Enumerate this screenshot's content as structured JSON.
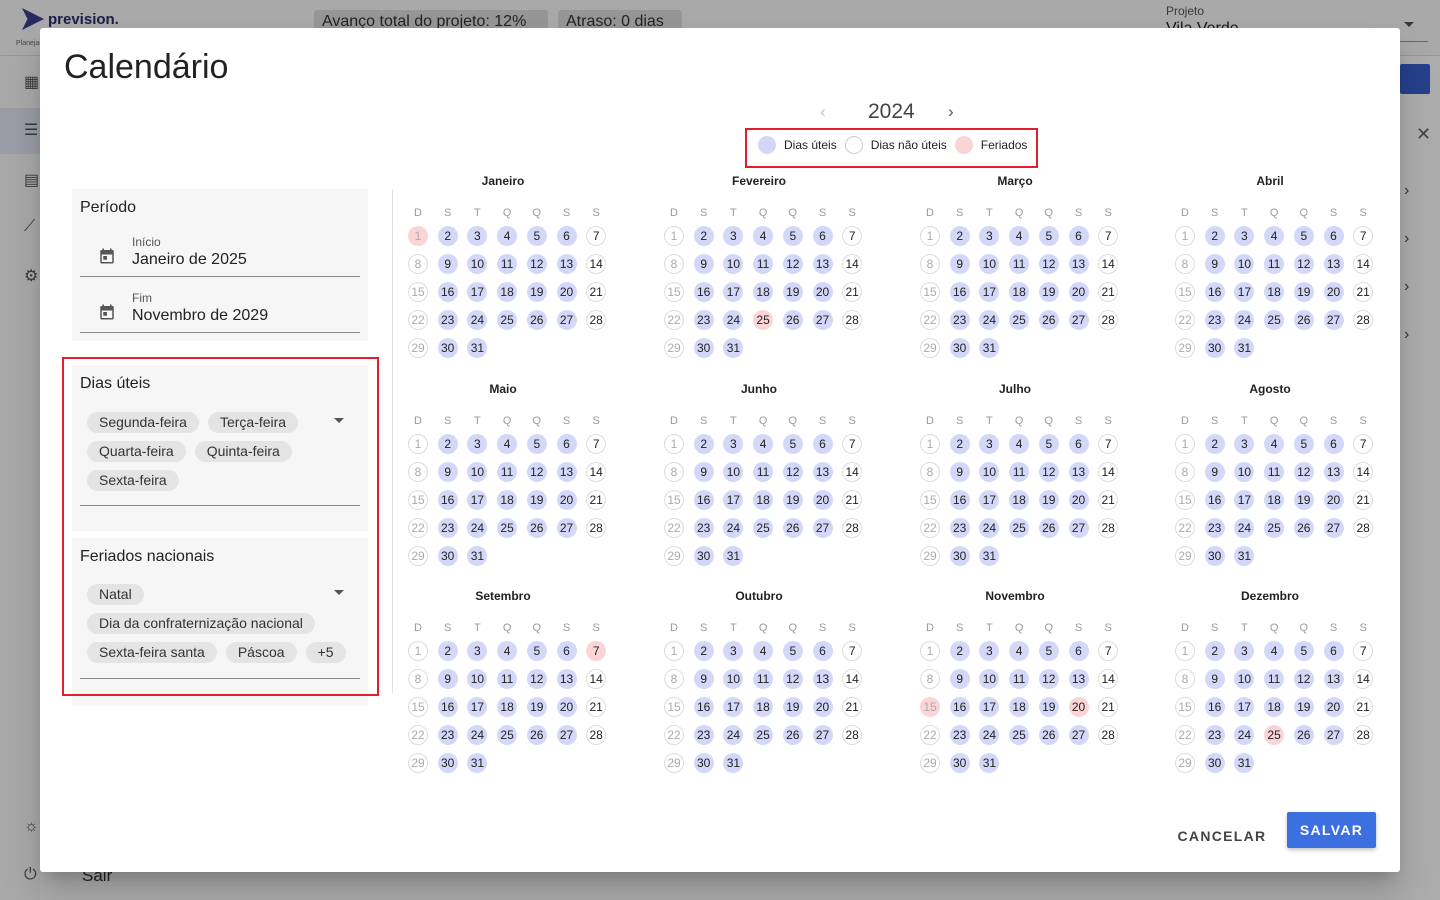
{
  "app": {
    "logo_text": "prevision.",
    "logo_sub": "Planejamento",
    "progress_chip": "Avanço total do projeto: 12%",
    "delay_chip": "Atraso: 0 dias",
    "project_label": "Projeto",
    "project_value": "Vila Verde",
    "exit_label": "Sair"
  },
  "dialog": {
    "title": "Calendário",
    "periodo": {
      "title": "Período",
      "start_label": "Início",
      "start_value": "Janeiro de 2025",
      "end_label": "Fim",
      "end_value": "Novembro de 2029"
    },
    "dias_uteis": {
      "title": "Dias úteis",
      "chips": [
        "Segunda-feira",
        "Terça-feira",
        "Quarta-feira",
        "Quinta-feira",
        "Sexta-feira"
      ]
    },
    "feriados": {
      "title": "Feriados nacionais",
      "chips": [
        "Natal",
        "Dia da confraternização nacional",
        "Sexta-feira santa",
        "Páscoa",
        "+5"
      ]
    },
    "year": "2024",
    "legend": {
      "work": "Dias úteis",
      "off": "Dias não úteis",
      "holiday": "Feriados",
      "colors": {
        "work": "#d3d8f8",
        "off": "#ffffff",
        "holiday": "#fbd5d5"
      }
    },
    "weekdays": [
      "D",
      "S",
      "T",
      "Q",
      "Q",
      "S",
      "S"
    ],
    "months": [
      {
        "name": "Janeiro",
        "days": 31,
        "holidays": [
          1
        ]
      },
      {
        "name": "Fevereiro",
        "days": 31,
        "holidays": [
          25
        ]
      },
      {
        "name": "Março",
        "days": 31,
        "holidays": []
      },
      {
        "name": "Abril",
        "days": 31,
        "holidays": []
      },
      {
        "name": "Maio",
        "days": 31,
        "holidays": []
      },
      {
        "name": "Junho",
        "days": 31,
        "holidays": []
      },
      {
        "name": "Julho",
        "days": 31,
        "holidays": []
      },
      {
        "name": "Agosto",
        "days": 31,
        "holidays": []
      },
      {
        "name": "Setembro",
        "days": 31,
        "holidays": [
          7
        ]
      },
      {
        "name": "Outubro",
        "days": 31,
        "holidays": []
      },
      {
        "name": "Novembro",
        "days": 31,
        "holidays": [
          15,
          20
        ],
        "extra_offs": [
          7
        ]
      },
      {
        "name": "Dezembro",
        "days": 31,
        "holidays": [
          25
        ]
      }
    ],
    "cancel_label": "CANCELAR",
    "save_label": "SALVAR"
  }
}
